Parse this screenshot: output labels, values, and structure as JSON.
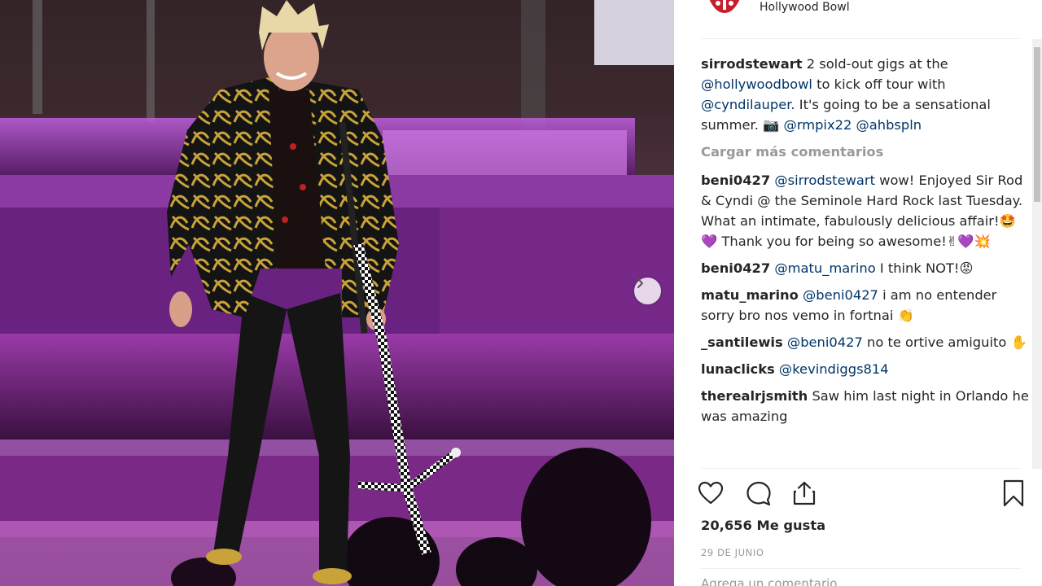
{
  "header": {
    "location": "Hollywood Bowl"
  },
  "caption": {
    "user": "sirrodstewart",
    "parts": [
      {
        "t": " 2 sold-out gigs at the "
      },
      {
        "m": "@hollywoodbowl"
      },
      {
        "t": " to kick off tour with "
      },
      {
        "m": "@cyndilauper"
      },
      {
        "t": ". It's going to be a sensational summer. 📷 "
      },
      {
        "m": "@rmpix22"
      },
      {
        "t": " "
      },
      {
        "m": "@ahbspln"
      }
    ]
  },
  "load_more": "Cargar más comentarios",
  "comments": [
    {
      "user": "beni0427",
      "parts": [
        {
          "m": "@sirrodstewart"
        },
        {
          "t": " wow! Enjoyed Sir Rod & Cyndi @ the Seminole Hard Rock last Tuesday. What an intimate, fabulously delicious affair!🤩💜 Thank you for being so awesome!✌💜💥"
        }
      ]
    },
    {
      "user": "beni0427",
      "parts": [
        {
          "m": "@matu_marino"
        },
        {
          "t": " I think NOT!😡"
        }
      ]
    },
    {
      "user": "matu_marino",
      "parts": [
        {
          "m": "@beni0427"
        },
        {
          "t": " i am no entender sorry bro nos vemo in fortnai 👏"
        }
      ]
    },
    {
      "user": "_santilewis",
      "parts": [
        {
          "m": "@beni0427"
        },
        {
          "t": " no te ortive amiguito ✋"
        }
      ]
    },
    {
      "user": "lunaclicks",
      "parts": [
        {
          "m": "@kevindiggs814"
        }
      ]
    },
    {
      "user": "therealrjsmith",
      "parts": [
        {
          "t": " Saw him last night in Orlando he was amazing"
        }
      ]
    }
  ],
  "likes": "20,656 Me gusta",
  "date": "29 DE JUNIO",
  "add_comment_placeholder": "Agrega un comentario...",
  "icons": {
    "like": "heart-icon",
    "comment": "comment-bubble-icon",
    "share": "share-icon",
    "save": "bookmark-icon",
    "next": "chevron-right-icon"
  },
  "colors": {
    "mention": "#003569",
    "muted": "#999999",
    "stage_purple": "#b040d0"
  }
}
